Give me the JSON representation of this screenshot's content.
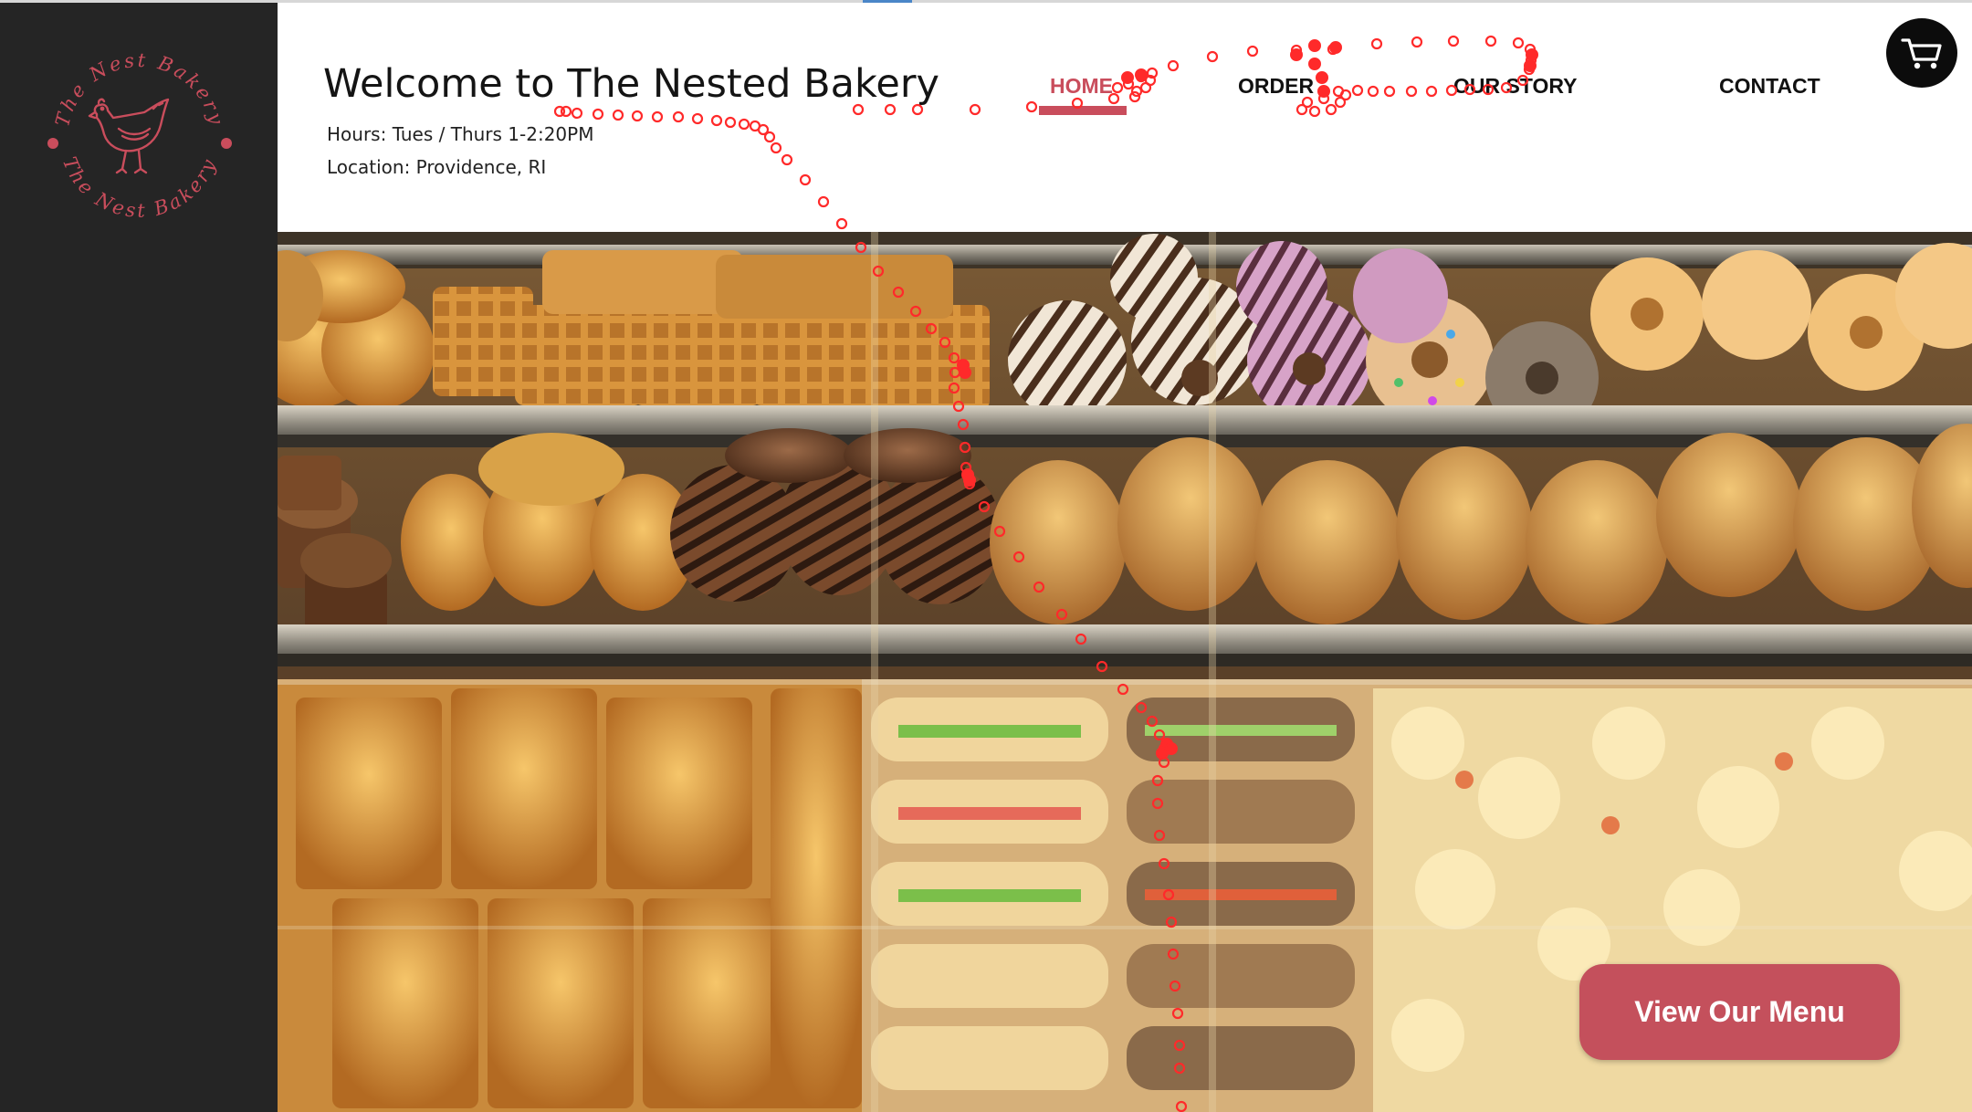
{
  "brand": {
    "logo_top_text": "The Nest Bakery",
    "logo_bottom_text": "The Nest Bakery",
    "accent_color": "#c94d5c"
  },
  "header": {
    "title": "Welcome to The Nested Bakery",
    "hours": "Hours: Tues / Thurs 1-2:20PM",
    "location": "Location: Providence, RI"
  },
  "nav": {
    "items": [
      {
        "label": "HOME",
        "active": true
      },
      {
        "label": "ORDER",
        "active": false
      },
      {
        "label": "OUR STORY",
        "active": false
      },
      {
        "label": "CONTACT",
        "active": false
      }
    ]
  },
  "cart": {
    "icon": "shopping-cart-icon"
  },
  "hero": {
    "image": "bakery-display-case-photo",
    "cta_label": "View Our Menu"
  },
  "overlay": {
    "icon": "cursor-trail-markers",
    "color": "#ff2a2a"
  }
}
